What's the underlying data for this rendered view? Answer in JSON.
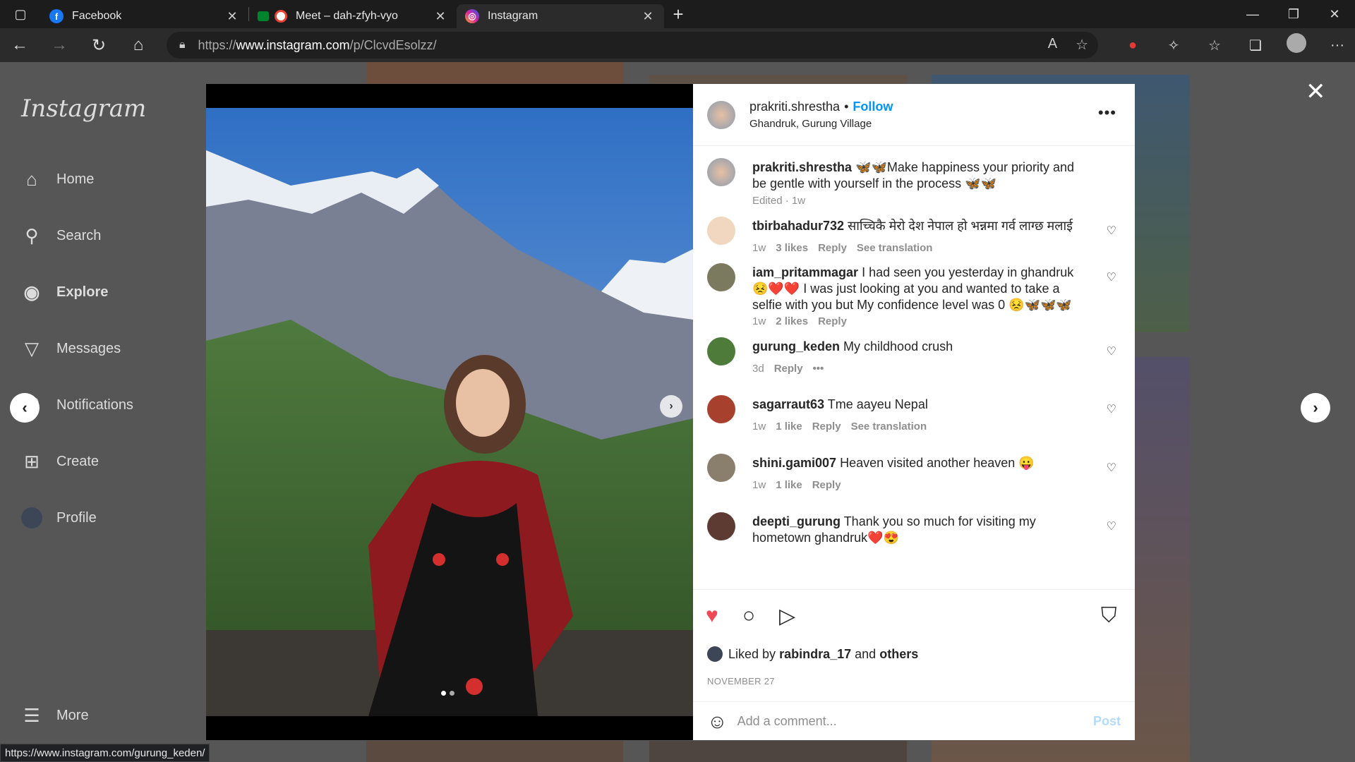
{
  "browser": {
    "tabs": [
      {
        "title": "Facebook",
        "favicon": "facebook-icon",
        "color": "#1877f2"
      },
      {
        "title": "Meet – dah-zfyh-vyo",
        "favicon": "meet-icon",
        "color": "#ea4335"
      },
      {
        "title": "Instagram",
        "favicon": "instagram-icon",
        "color": "#d6249f"
      }
    ],
    "url_prefix": "https://",
    "url_domain": "www.instagram.com",
    "url_path": "/p/ClcvdEsolzz/",
    "status_url": "https://www.instagram.com/gurung_keden/"
  },
  "sidebar": {
    "logo": "Instagram",
    "items": [
      {
        "label": "Home",
        "icon": "home-icon"
      },
      {
        "label": "Search",
        "icon": "search-icon"
      },
      {
        "label": "Explore",
        "icon": "explore-icon"
      },
      {
        "label": "Messages",
        "icon": "messages-icon"
      },
      {
        "label": "Notifications",
        "icon": "heart-icon"
      },
      {
        "label": "Create",
        "icon": "create-icon"
      },
      {
        "label": "Profile",
        "icon": "profile-avatar"
      },
      {
        "label": "More",
        "icon": "menu-icon"
      }
    ]
  },
  "post": {
    "username": "prakriti.shrestha",
    "dot": "•",
    "follow": "Follow",
    "location": "Ghandruk, Gurung Village",
    "caption": {
      "user": "prakriti.shrestha",
      "text": "🦋🦋Make happiness your priority and be gentle with yourself in the process 🦋🦋",
      "meta": "Edited · 1w"
    },
    "comments": [
      {
        "user": "tbirbahadur732",
        "text": "साच्चिकै मेरो देश नेपाल हो भन्नमा गर्व लाग्छ मलाई",
        "time": "1w",
        "likes": "3 likes",
        "reply": "Reply",
        "extra": "See translation"
      },
      {
        "user": "iam_pritammagar",
        "text": "I had seen you yesterday in ghandruk 😣❤️❤️ I was just looking at you and wanted to take a selfie with you but My confidence level was 0 😣🦋🦋🦋",
        "time": "1w",
        "likes": "2 likes",
        "reply": "Reply",
        "extra": ""
      },
      {
        "user": "gurung_keden",
        "text": "My childhood crush",
        "time": "3d",
        "likes": "",
        "reply": "Reply",
        "extra": "•••"
      },
      {
        "user": "sagarraut63",
        "text": "Tme aayeu Nepal",
        "time": "1w",
        "likes": "1 like",
        "reply": "Reply",
        "extra": "See translation"
      },
      {
        "user": "shini.gami007",
        "text": "Heaven visited another heaven 😛",
        "time": "1w",
        "likes": "1 like",
        "reply": "Reply",
        "extra": ""
      },
      {
        "user": "deepti_gurung",
        "text": "Thank you so much for visiting my hometown ghandruk❤️😍",
        "time": "",
        "likes": "",
        "reply": "",
        "extra": ""
      }
    ],
    "liked_by_prefix": "Liked by",
    "liked_by_user": "rabindra_17",
    "liked_by_and": "and",
    "liked_by_others": "others",
    "date": "NOVEMBER 27",
    "add_comment_placeholder": "Add a comment...",
    "post_button": "Post",
    "liked": true,
    "like_color": "#ed4956"
  }
}
